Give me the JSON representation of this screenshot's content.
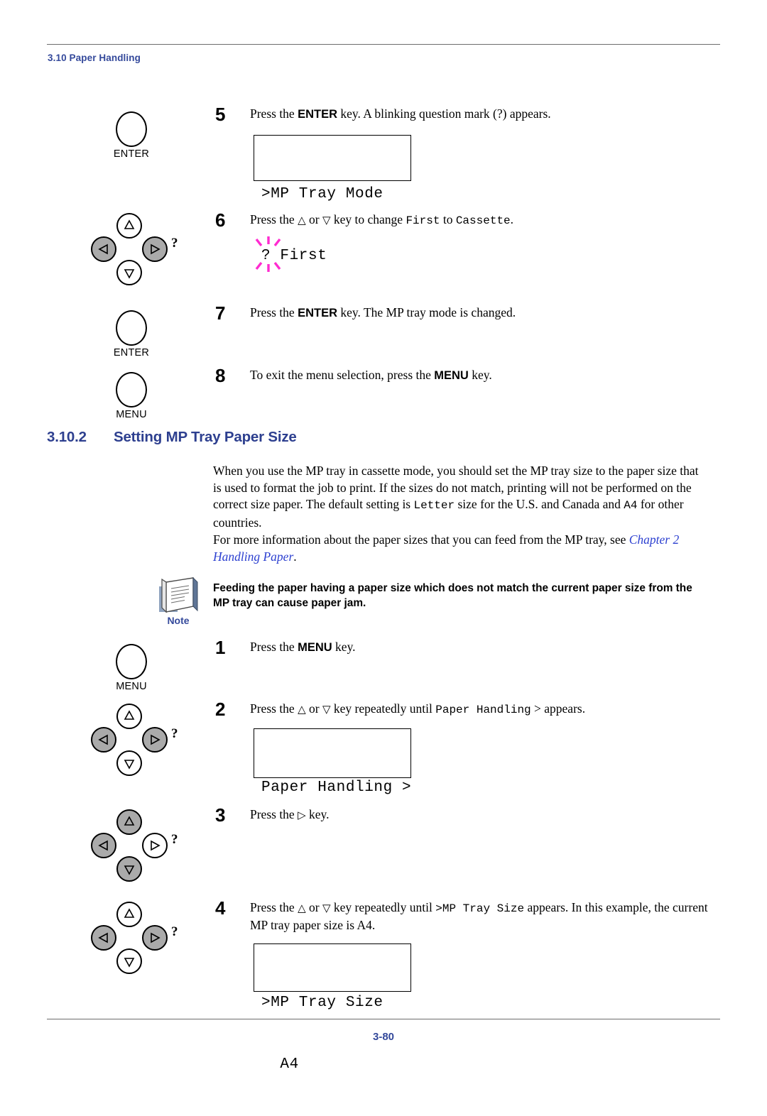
{
  "header": {
    "section_label": "3.10 Paper Handling"
  },
  "footer": {
    "page_number": "3-80"
  },
  "colors": {
    "heading_blue": "#2d3f8f",
    "label_blue": "#34499b",
    "link_blue": "#2b3fd0",
    "blink_magenta": "#ff2bd0",
    "key_fill_gray": "#aaaaaa"
  },
  "steps_top": [
    {
      "number": "5",
      "key_label": "ENTER",
      "text_parts": [
        {
          "t": "Press the ",
          "s": "plain"
        },
        {
          "t": "ENTER",
          "s": "bold"
        },
        {
          "t": " key. A blinking question mark (?) appears.",
          "s": "plain"
        }
      ]
    },
    {
      "number": "6",
      "text_parts": [
        {
          "t": "Press the ",
          "s": "plain"
        },
        {
          "t": "△",
          "s": "tri"
        },
        {
          "t": " or ",
          "s": "plain"
        },
        {
          "t": "▽",
          "s": "tri"
        },
        {
          "t": " key to change ",
          "s": "plain"
        },
        {
          "t": "First",
          "s": "mono"
        },
        {
          "t": " to ",
          "s": "plain"
        },
        {
          "t": "Cassette",
          "s": "mono"
        },
        {
          "t": ".",
          "s": "plain"
        }
      ]
    },
    {
      "number": "7",
      "key_label": "ENTER",
      "text_parts": [
        {
          "t": "Press the ",
          "s": "plain"
        },
        {
          "t": "ENTER",
          "s": "bold"
        },
        {
          "t": " key. The MP tray mode is changed.",
          "s": "plain"
        }
      ]
    },
    {
      "number": "8",
      "key_label": "MENU",
      "text_parts": [
        {
          "t": "To exit the menu selection, press the ",
          "s": "plain"
        },
        {
          "t": "MENU",
          "s": "bold"
        },
        {
          "t": " key.",
          "s": "plain"
        }
      ]
    }
  ],
  "lcd_displays": {
    "mp_tray_mode": {
      "line1": ">MP Tray Mode",
      "line2_prefix": "?",
      "line2_value": " First",
      "blinking": true
    },
    "paper_handling": {
      "line1": "Paper Handling >",
      "line2": ""
    },
    "mp_tray_size": {
      "line1": ">MP Tray Size",
      "line2": "  A4"
    }
  },
  "section": {
    "number": "3.10.2",
    "title": "Setting MP Tray Paper Size",
    "paragraph1_parts": [
      {
        "t": "When you use the MP tray in cassette mode, you should set the MP tray size to the paper size that is used to format the job to print. If the sizes do not match, printing will not be performed on the correct size paper. The default setting is ",
        "s": "plain"
      },
      {
        "t": "Letter",
        "s": "mono"
      },
      {
        "t": " size for the U.S. and Canada and ",
        "s": "plain"
      },
      {
        "t": "A4",
        "s": "mono"
      },
      {
        "t": " for other countries.",
        "s": "plain"
      }
    ],
    "paragraph2_parts": [
      {
        "t": "For more information about the paper sizes that you can feed from the MP tray, see ",
        "s": "plain"
      },
      {
        "t": "Chapter 2 Handling Paper",
        "s": "xref"
      },
      {
        "t": ".",
        "s": "plain"
      }
    ]
  },
  "note": {
    "label": "Note",
    "text": "Feeding the paper having a paper size which does not match the current paper size from the MP tray can cause paper jam."
  },
  "steps_bottom": [
    {
      "number": "1",
      "key_label": "MENU",
      "text_parts": [
        {
          "t": "Press the ",
          "s": "plain"
        },
        {
          "t": "MENU",
          "s": "bold"
        },
        {
          "t": " key.",
          "s": "plain"
        }
      ]
    },
    {
      "number": "2",
      "text_parts": [
        {
          "t": "Press the ",
          "s": "plain"
        },
        {
          "t": "△",
          "s": "tri"
        },
        {
          "t": " or ",
          "s": "plain"
        },
        {
          "t": "▽",
          "s": "tri"
        },
        {
          "t": " key repeatedly until ",
          "s": "plain"
        },
        {
          "t": "Paper Handling",
          "s": "mono"
        },
        {
          "t": " > appears.",
          "s": "plain"
        }
      ]
    },
    {
      "number": "3",
      "text_parts": [
        {
          "t": "Press the ",
          "s": "plain"
        },
        {
          "t": "▷",
          "s": "tri"
        },
        {
          "t": " key.",
          "s": "plain"
        }
      ]
    },
    {
      "number": "4",
      "text_parts": [
        {
          "t": "Press the ",
          "s": "plain"
        },
        {
          "t": "△",
          "s": "tri"
        },
        {
          "t": " or ",
          "s": "plain"
        },
        {
          "t": "▽",
          "s": "tri"
        },
        {
          "t": " key repeatedly until ",
          "s": "plain"
        },
        {
          "t": ">MP Tray Size",
          "s": "mono"
        },
        {
          "t": " appears. In this example, the current MP tray paper size is A4.",
          "s": "plain"
        }
      ]
    }
  ],
  "key_clusters": {
    "step6": {
      "up": "white",
      "down": "white",
      "left": "gray",
      "right": "gray",
      "hint": "?"
    },
    "step2": {
      "up": "white",
      "down": "white",
      "left": "gray",
      "right": "gray",
      "hint": "?"
    },
    "step3": {
      "up": "gray",
      "down": "gray",
      "left": "gray",
      "right": "white",
      "hint": "?"
    },
    "step4": {
      "up": "white",
      "down": "white",
      "left": "gray",
      "right": "gray",
      "hint": "?"
    }
  }
}
